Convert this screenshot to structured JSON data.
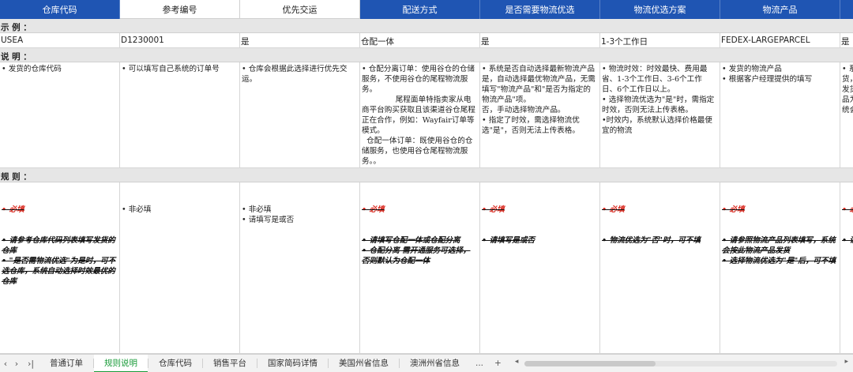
{
  "columns": [
    {
      "label": "仓库代码",
      "style": "blue"
    },
    {
      "label": "参考编号",
      "style": "white"
    },
    {
      "label": "优先交运",
      "style": "white"
    },
    {
      "label": "配送方式",
      "style": "blue"
    },
    {
      "label": "是否需要物流优选",
      "style": "blue"
    },
    {
      "label": "物流优选方案",
      "style": "blue"
    },
    {
      "label": "物流产品",
      "style": "blue"
    },
    {
      "label": "",
      "style": "blue"
    }
  ],
  "sections": {
    "example": "示 例 ：",
    "description": "说 明 ：",
    "rules": "规 则 ："
  },
  "example_row": [
    "USEA",
    "D1230001",
    "是",
    "仓配一体",
    "是",
    "1-3个工作日",
    "FEDEX-LARGEPARCEL",
    "是"
  ],
  "description_row": [
    "• 发货的仓库代码",
    "• 可以填写自己系统的订单号",
    "• 仓库会根据此选择进行优先交运。",
    "• 仓配分离订单：使用谷仓的仓储服务，不使用谷仓的尾程物流服务。\n              尾程面单特指卖家从电商平台购买获取且该渠道谷仓尾程正在合作，例如：Wayfair订单等模式。\n  仓配一体订单：既使用谷仓的仓储服务，也使用谷仓尾程物流服务。。",
    "• 系统是否自动选择最新物流产品\n是，自动选择最优物流产品，无需填写\"物流产品\"和\"是否为指定的物流产品\"项。\n否，手动选择物流产品。\n• 指定了时效，需选择物流优选\"是\"，否则无法上传表格。",
    "• 物流时效：时效最快、费用最省、1-3个工作日、3-6个工作日、6个工作日以上。\n• 选择物流优选为\"是\"时，需指定时效，否则无法上传表格。\n•时效内，系统默认选择价格最便宜的物流",
    "• 发货的物流产品\n• 根据客户经理提供的填写",
    "• 系\n货，\n发货\n品为\n统会"
  ],
  "rules_row": [
    {
      "required": "• 必填",
      "text": "• 请参考仓库代码列表填写发货的仓库\n• \"是否需物流优选\"为是时，可不选仓库，系统自动选择时效最优的仓库"
    },
    {
      "required": "",
      "text": "• 非必填"
    },
    {
      "required": "",
      "text": "• 非必填\n• 请填写是或否"
    },
    {
      "required": "• 必填",
      "text": "• 请填写仓配一体或仓配分离\n• 仓配分离 需开通服务可选择，否则默认为仓配一体"
    },
    {
      "required": "• 必填",
      "text": "• 请填写是或否"
    },
    {
      "required": "• 必填",
      "text": "• 物流优选为\"否\"时，可不填"
    },
    {
      "required": "• 必填",
      "text": "• 请参照物流产品列表填写，系统会按此物流产品发货\n• 选择物流优选为\"是\"后，可不填"
    },
    {
      "required": "• 必",
      "text": "• 请"
    }
  ],
  "tabs": [
    "普通订单",
    "规则说明",
    "仓库代码",
    "销售平台",
    "国家简码详情",
    "美国州省信息",
    "澳洲州省信息"
  ],
  "active_tab": "规则说明",
  "nav": {
    "prev": "‹",
    "next": "›",
    "last": "›|",
    "more": "...",
    "add": "+"
  }
}
